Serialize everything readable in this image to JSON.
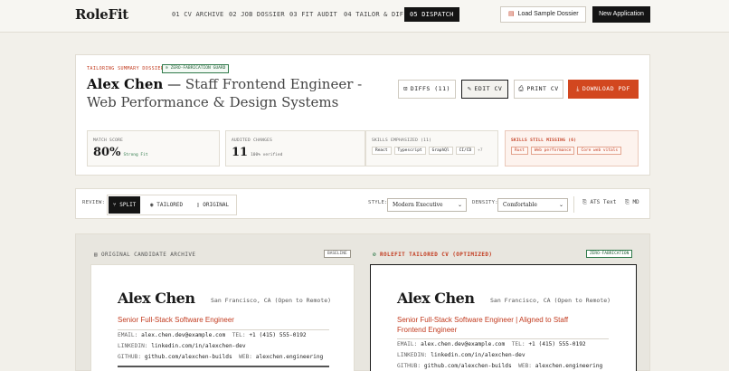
{
  "app": {
    "logo": "RoleFit"
  },
  "nav": {
    "tabs": [
      {
        "label": "01 CV ARCHIVE"
      },
      {
        "label": "02 JOB DOSSIER"
      },
      {
        "label": "03 FIT AUDIT"
      },
      {
        "label": "04 TAILOR & DIFF"
      },
      {
        "label": "05 DISPATCH"
      }
    ],
    "active_tab": "05 DISPATCH",
    "load_sample": "Load Sample Dossier",
    "new_application": "New Application"
  },
  "summary": {
    "kicker": "TAILORING SUMMARY DOSSIER",
    "badge": "ZERO-FABRICATION GUARD",
    "candidate": "Alex Chen",
    "separator": "—",
    "role_title": "Staff Frontend Engineer - Web Performance & Design Systems",
    "actions": {
      "diffs": "DIFFS (11)",
      "edit": "EDIT CV",
      "print": "PRINT CV",
      "download": "DOWNLOAD PDF"
    },
    "stats": {
      "match_label": "MATCH SCORE",
      "match_value": "80%",
      "match_note": "Strong Fit",
      "audited_label": "AUDITED CHANGES",
      "audited_value": "11",
      "audited_note": "100% verified",
      "emph_label": "SKILLS EMPHASIZED (11)",
      "emph_skills": [
        "React",
        "Typescript",
        "GraphQl",
        "CI/CD"
      ],
      "emph_more": "+7",
      "missing_label": "SKILLS STILL MISSING (6)",
      "missing_skills": [
        "Rust",
        "Web performance",
        "Core web vitals"
      ]
    }
  },
  "review": {
    "label": "REVIEW:",
    "modes": [
      "SPLIT",
      "TAILORED",
      "ORIGINAL"
    ],
    "active_mode": "SPLIT",
    "style_label": "STYLE:",
    "style_value": "Modern Executive",
    "density_label": "DENSITY:",
    "density_value": "Comfortable",
    "ats_text": "ATS Text",
    "md": "MD"
  },
  "panes": {
    "original": {
      "header": "ORIGINAL CANDIDATE ARCHIVE",
      "badge": "BASELINE",
      "name": "Alex Chen",
      "location": "San Francisco, CA (Open to Remote)",
      "role": "Senior Full-Stack Software Engineer",
      "email_k": "EMAIL:",
      "email": "alex.chen.dev@example.com",
      "tel_k": "TEL:",
      "tel": "+1 (415) 555-0192",
      "linkedin_k": "LINKEDIN:",
      "linkedin": "linkedin.com/in/alexchen-dev",
      "github_k": "GITHUB:",
      "github": "github.com/alexchen-builds",
      "web_k": "WEB:",
      "web": "alexchen.engineering"
    },
    "tailored": {
      "header": "ROLEFIT TAILORED CV (OPTIMIZED)",
      "badge": "ZERO-FABRICATION",
      "name": "Alex Chen",
      "location": "San Francisco, CA (Open to Remote)",
      "role": "Senior Full-Stack Software Engineer | Aligned to Staff Frontend Engineer",
      "email_k": "EMAIL:",
      "email": "alex.chen.dev@example.com",
      "tel_k": "TEL:",
      "tel": "+1 (415) 555-0192",
      "linkedin_k": "LINKEDIN:",
      "linkedin": "linkedin.com/in/alexchen-dev",
      "github_k": "GITHUB:",
      "github": "github.com/alexchen-builds",
      "web_k": "WEB:",
      "web": "alexchen.engineering"
    }
  }
}
